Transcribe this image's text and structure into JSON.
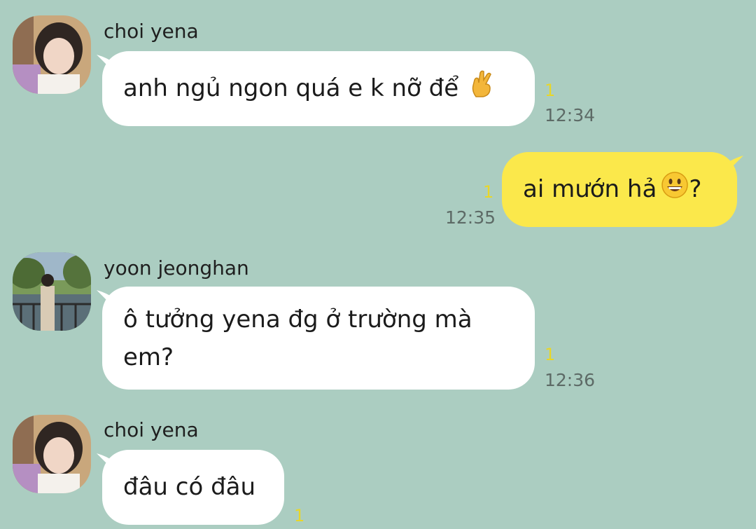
{
  "colors": {
    "background": "#abcdc1",
    "incoming_bubble": "#ffffff",
    "outgoing_bubble": "#fbe84b",
    "unread": "#e8d629",
    "timestamp": "#5d6a66"
  },
  "messages": [
    {
      "sender": "choi yena",
      "text": "anh ngủ ngon quá e k nỡ để",
      "emoji": "crossed-fingers-icon",
      "unread": "1",
      "time": "12:34",
      "direction": "incoming"
    },
    {
      "text": "ai mướn hả",
      "emoji": "grinning-face-icon",
      "suffix": "?",
      "unread": "1",
      "time": "12:35",
      "direction": "outgoing"
    },
    {
      "sender": "yoon jeonghan",
      "text": "ô tưởng yena đg ở trường mà em?",
      "unread": "1",
      "time": "12:36",
      "direction": "incoming"
    },
    {
      "sender": "choi yena",
      "text": "đâu có đâu",
      "unread": "1",
      "direction": "incoming"
    }
  ]
}
